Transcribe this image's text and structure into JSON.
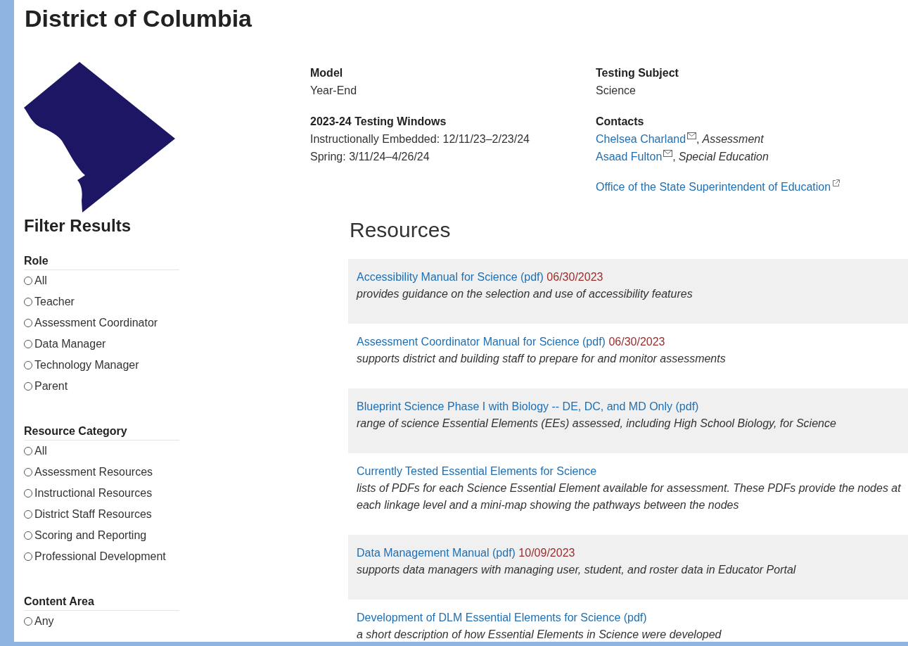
{
  "page_title": "District of Columbia",
  "info": {
    "model": {
      "label": "Model",
      "value": "Year-End"
    },
    "testing_subject": {
      "label": "Testing Subject",
      "value": "Science"
    },
    "testing_windows": {
      "label": "2023-24 Testing Windows",
      "lines": [
        "Instructionally Embedded: 12/11/23–2/23/24",
        "Spring: 3/11/24–4/26/24"
      ]
    },
    "contacts": {
      "label": "Contacts",
      "people": [
        {
          "name": "Chelsea Charland",
          "separator": ",",
          "role": "Assessment"
        },
        {
          "name": "Asaad Fulton",
          "separator": ",",
          "role": "Special Education"
        }
      ],
      "agency_link": "Office of the State Superintendent of Education"
    }
  },
  "filters": {
    "title": "Filter Results",
    "groups": [
      {
        "label": "Role",
        "options": [
          {
            "label": "All",
            "checked": false
          },
          {
            "label": "Teacher",
            "checked": false
          },
          {
            "label": "Assessment Coordinator",
            "checked": false
          },
          {
            "label": "Data Manager",
            "checked": false
          },
          {
            "label": "Technology Manager",
            "checked": false
          },
          {
            "label": "Parent",
            "checked": false
          }
        ]
      },
      {
        "label": "Resource Category",
        "options": [
          {
            "label": "All",
            "checked": false
          },
          {
            "label": "Assessment Resources",
            "checked": false
          },
          {
            "label": "Instructional Resources",
            "checked": false
          },
          {
            "label": "District Staff Resources",
            "checked": false
          },
          {
            "label": "Scoring and Reporting",
            "checked": false
          },
          {
            "label": "Professional Development",
            "checked": false
          }
        ]
      },
      {
        "label": "Content Area",
        "options": [
          {
            "label": "Any",
            "checked": false
          }
        ]
      }
    ]
  },
  "resources": {
    "title": "Resources",
    "items": [
      {
        "title": "Accessibility Manual for Science (pdf)",
        "date": "06/30/2023",
        "description": "provides guidance on the selection and use of accessibility features"
      },
      {
        "title": "Assessment Coordinator Manual for Science (pdf)",
        "date": "06/30/2023",
        "description": "supports district and building staff to prepare for and monitor assessments"
      },
      {
        "title": "Blueprint Science Phase I with Biology -- DE, DC, and MD Only (pdf)",
        "description": "range of science Essential Elements (EEs) assessed, including High School Biology, for Science"
      },
      {
        "title": "Currently Tested Essential Elements for Science",
        "description": "lists of PDFs for each Science Essential Element available for assessment. These PDFs provide the nodes at each linkage level and a mini-map showing the pathways between the nodes"
      },
      {
        "title": "Data Management Manual (pdf)",
        "date": "10/09/2023",
        "description": "supports data managers with managing user, student, and roster data in Educator Portal"
      },
      {
        "title": "Development of DLM Essential Elements for Science (pdf)",
        "description": "a short description of how Essential Elements in Science were developed"
      }
    ]
  }
}
